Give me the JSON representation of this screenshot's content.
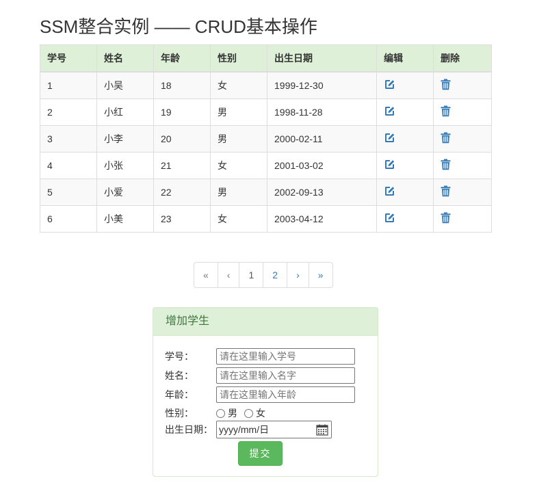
{
  "page": {
    "title": "SSM整合实例 —— CRUD基本操作"
  },
  "table": {
    "headers": [
      "学号",
      "姓名",
      "年龄",
      "性别",
      "出生日期",
      "编辑",
      "删除"
    ],
    "rows": [
      {
        "id": "1",
        "name": "小吴",
        "age": "18",
        "gender": "女",
        "birth": "1999-12-30"
      },
      {
        "id": "2",
        "name": "小红",
        "age": "19",
        "gender": "男",
        "birth": "1998-11-28"
      },
      {
        "id": "3",
        "name": "小李",
        "age": "20",
        "gender": "男",
        "birth": "2000-02-11"
      },
      {
        "id": "4",
        "name": "小张",
        "age": "21",
        "gender": "女",
        "birth": "2001-03-02"
      },
      {
        "id": "5",
        "name": "小爱",
        "age": "22",
        "gender": "男",
        "birth": "2002-09-13"
      },
      {
        "id": "6",
        "name": "小美",
        "age": "23",
        "gender": "女",
        "birth": "2003-04-12"
      }
    ],
    "edit_icon": "edit-icon",
    "delete_icon": "trash-icon",
    "icon_color": "#337ab7",
    "header_bg": "#dff0d8"
  },
  "pagination": {
    "first": "«",
    "prev": "‹",
    "pages": [
      "1",
      "2"
    ],
    "current_page": "1",
    "next": "›",
    "last": "»"
  },
  "add_form": {
    "heading": "增加学生",
    "id_label": "学号：",
    "id_placeholder": "请在这里输入学号",
    "name_label": "姓名：",
    "name_placeholder": "请在这里输入名字",
    "age_label": "年龄：",
    "age_placeholder": "请在这里输入年龄",
    "gender_label": "性别：",
    "gender_options": [
      "男",
      "女"
    ],
    "birth_label": "出生日期：",
    "birth_placeholder": "yyyy/mm/日",
    "calendar_icon": "calendar-icon",
    "submit_label": "提交",
    "submit_color": "#5cb85c",
    "heading_color": "#3c763d"
  }
}
